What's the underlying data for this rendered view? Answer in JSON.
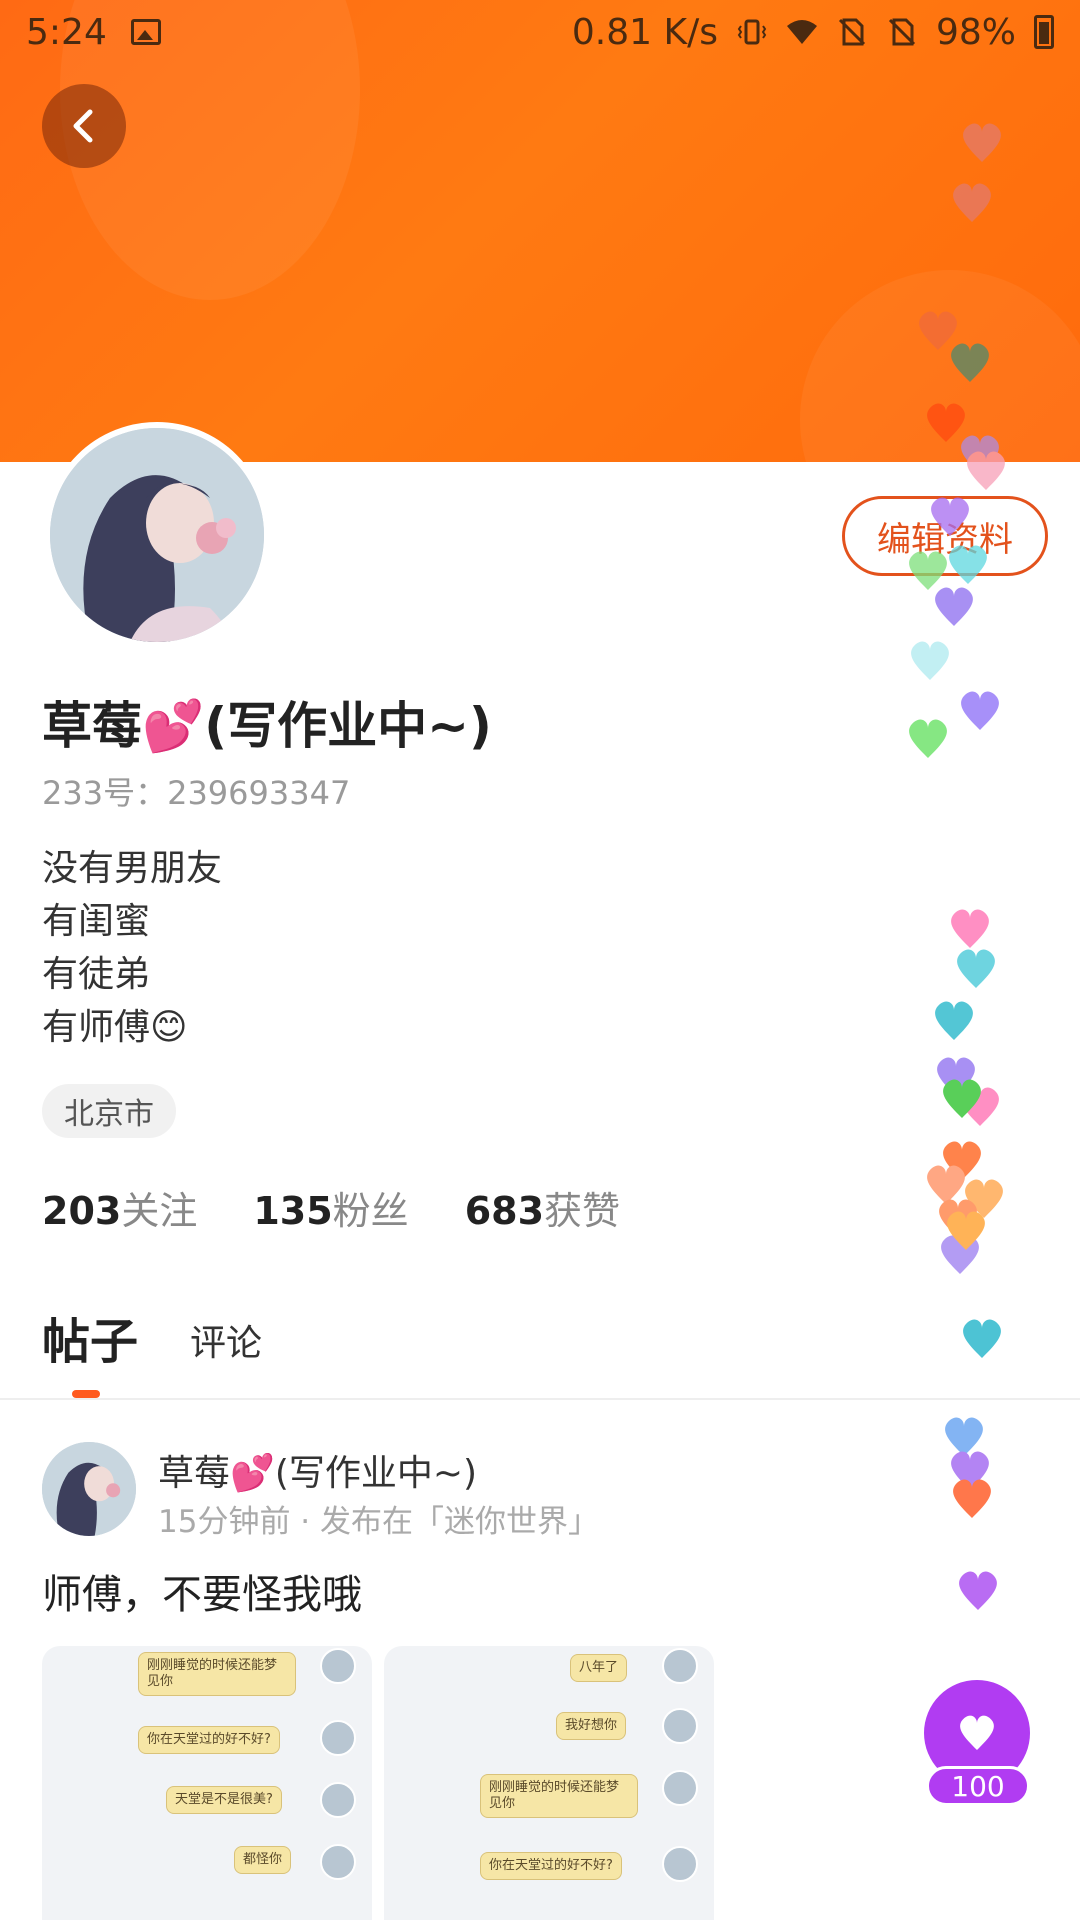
{
  "status_bar": {
    "time": "5:24",
    "network_speed": "0.81 K/s",
    "battery": "98%",
    "icons": [
      "image-icon",
      "vibrate-icon",
      "wifi-icon",
      "no-sim-icon",
      "no-sim-icon",
      "battery-charging-icon"
    ]
  },
  "colors": {
    "banner": "#ff7114",
    "accent": "#ff5a1e",
    "edit_button": "#e3521c",
    "like_button": "#b13cf2"
  },
  "profile": {
    "name": "草莓💕(写作业中~)",
    "id_label": "233号：239693347",
    "bio": [
      "没有男朋友",
      "有闺蜜",
      "有徒弟",
      "有师傅😊"
    ],
    "location": "北京市",
    "edit_button": "编辑资料",
    "stats": [
      {
        "num": "203",
        "label": "关注"
      },
      {
        "num": "135",
        "label": "粉丝"
      },
      {
        "num": "683",
        "label": "获赞"
      }
    ]
  },
  "tabs": {
    "active": "帖子",
    "other": "评论"
  },
  "post": {
    "author": "草莓💕(写作业中~)",
    "meta": "15分钟前 · 发布在「迷你世界」",
    "text": "师傅，不要怪我哦",
    "image1_messages": [
      "刚刚睡觉的时候还能梦见你",
      "你在天堂过的好不好?",
      "天堂是不是很美?",
      "都怪你"
    ],
    "image2_messages": [
      "八年了",
      "我好想你",
      "刚刚睡觉的时候还能梦见你",
      "你在天堂过的好不好?"
    ]
  },
  "like": {
    "count": "100"
  }
}
